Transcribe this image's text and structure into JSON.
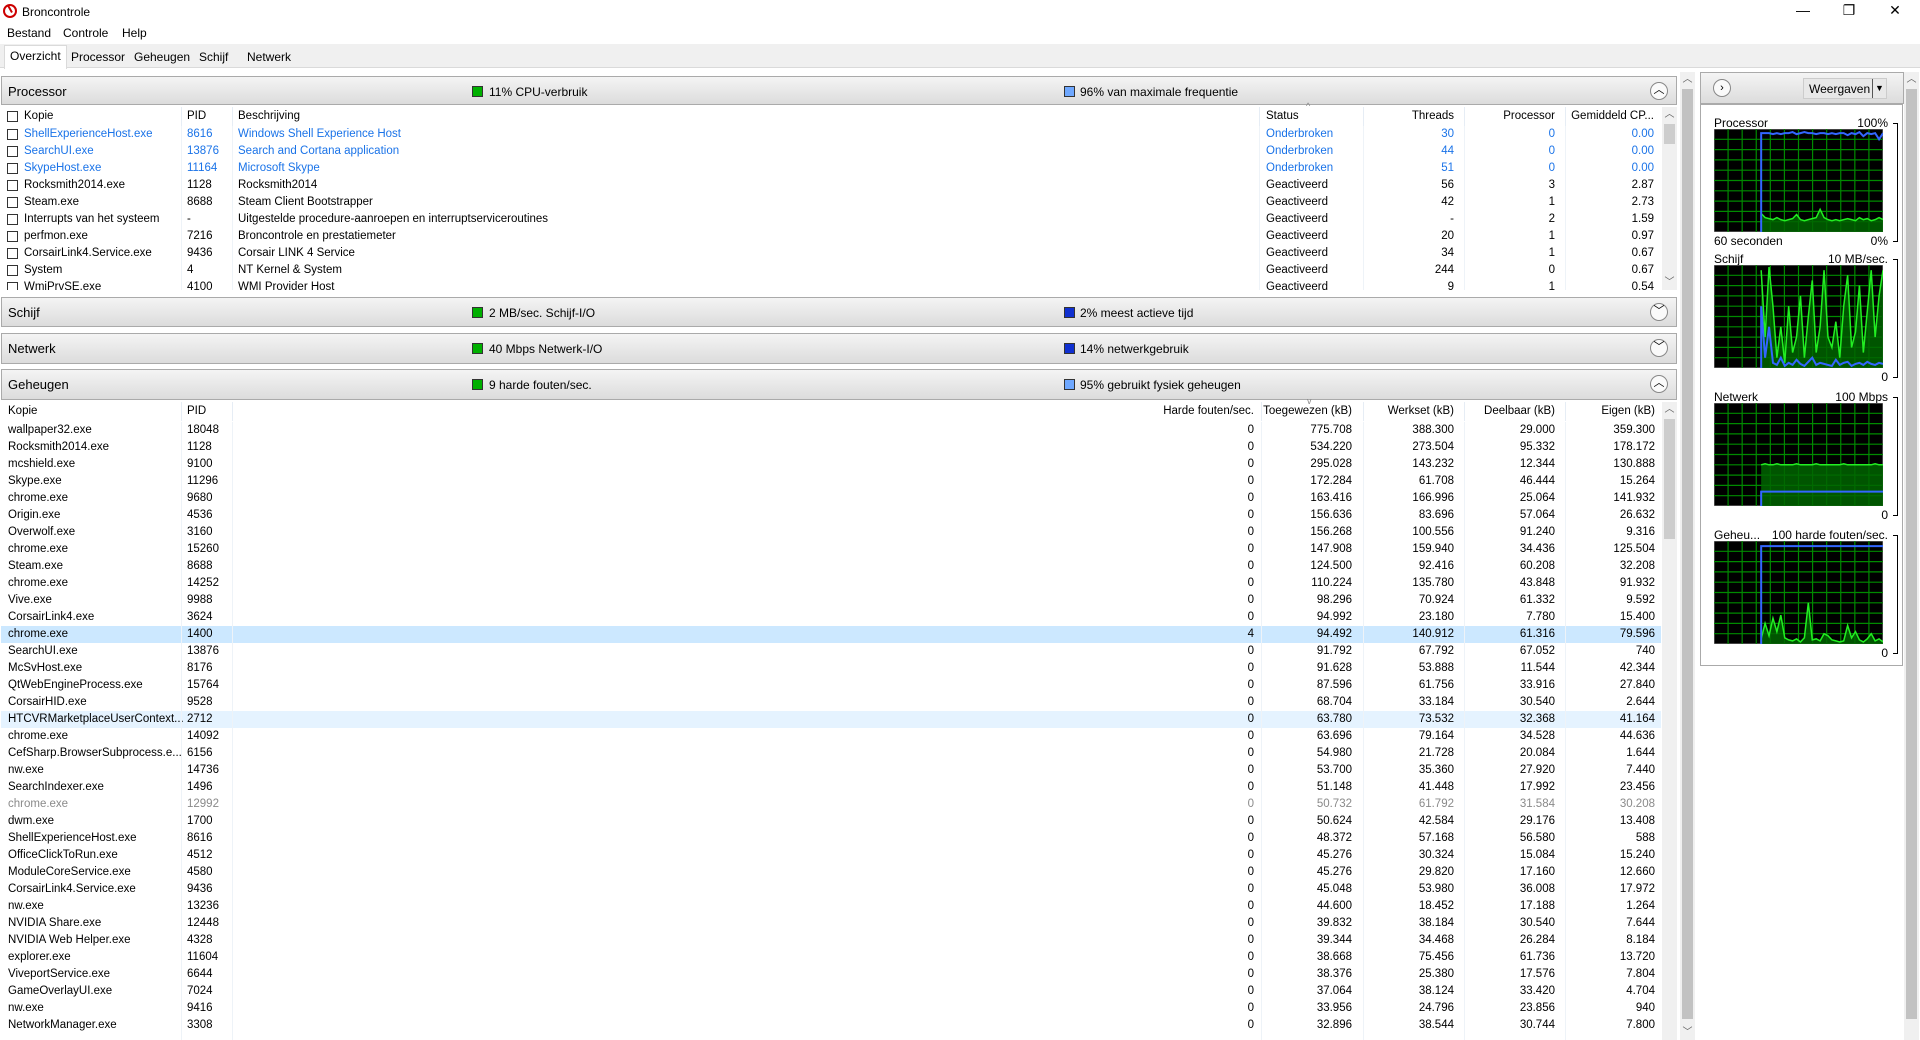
{
  "window": {
    "title": "Broncontrole",
    "minimize": "—",
    "restore": "❐",
    "close": "✕"
  },
  "menu": [
    "Bestand",
    "Controle",
    "Help"
  ],
  "tabs": [
    "Overzicht",
    "Processor",
    "Geheugen",
    "Schijf",
    "Netwerk"
  ],
  "colors": {
    "green": "#00b000",
    "blue": "#3366ff",
    "suspended": "#1a73e8",
    "selected": "#cce8ff",
    "hover": "#e5f3ff"
  },
  "processor": {
    "title": "Processor",
    "metric1": "11% CPU-verbruik",
    "metric2": "96% van maximale frequentie",
    "columns": [
      "Kopie",
      "PID",
      "Beschrijving",
      "Status",
      "Threads",
      "Processor",
      "Gemiddeld CP..."
    ],
    "rows": [
      {
        "name": "ShellExperienceHost.exe",
        "pid": "8616",
        "desc": "Windows Shell Experience Host",
        "status": "Onderbroken",
        "threads": "30",
        "cpu": "0",
        "avg": "0.00",
        "suspended": true
      },
      {
        "name": "SearchUI.exe",
        "pid": "13876",
        "desc": "Search and Cortana application",
        "status": "Onderbroken",
        "threads": "44",
        "cpu": "0",
        "avg": "0.00",
        "suspended": true
      },
      {
        "name": "SkypeHost.exe",
        "pid": "11164",
        "desc": "Microsoft Skype",
        "status": "Onderbroken",
        "threads": "51",
        "cpu": "0",
        "avg": "0.00",
        "suspended": true
      },
      {
        "name": "Rocksmith2014.exe",
        "pid": "1128",
        "desc": "Rocksmith2014",
        "status": "Geactiveerd",
        "threads": "56",
        "cpu": "3",
        "avg": "2.87"
      },
      {
        "name": "Steam.exe",
        "pid": "8688",
        "desc": "Steam Client Bootstrapper",
        "status": "Geactiveerd",
        "threads": "42",
        "cpu": "1",
        "avg": "2.73"
      },
      {
        "name": "Interrupts van het systeem",
        "pid": "-",
        "desc": "Uitgestelde procedure-aanroepen en interruptserviceroutines",
        "status": "Geactiveerd",
        "threads": "-",
        "cpu": "2",
        "avg": "1.59"
      },
      {
        "name": "perfmon.exe",
        "pid": "7216",
        "desc": "Broncontrole en prestatiemeter",
        "status": "Geactiveerd",
        "threads": "20",
        "cpu": "1",
        "avg": "0.97"
      },
      {
        "name": "CorsairLink4.Service.exe",
        "pid": "9436",
        "desc": "Corsair LINK 4 Service",
        "status": "Geactiveerd",
        "threads": "34",
        "cpu": "1",
        "avg": "0.67"
      },
      {
        "name": "System",
        "pid": "4",
        "desc": "NT Kernel & System",
        "status": "Geactiveerd",
        "threads": "244",
        "cpu": "0",
        "avg": "0.67"
      },
      {
        "name": "WmiPrvSE.exe",
        "pid": "4100",
        "desc": "WMI Provider Host",
        "status": "Geactiveerd",
        "threads": "9",
        "cpu": "1",
        "avg": "0.54"
      }
    ]
  },
  "disk": {
    "title": "Schijf",
    "metric1": "2 MB/sec. Schijf-I/O",
    "metric2": "2% meest actieve tijd"
  },
  "network": {
    "title": "Netwerk",
    "metric1": "40 Mbps  Netwerk-I/O",
    "metric2": "14% netwerkgebruik"
  },
  "memory": {
    "title": "Geheugen",
    "metric1": "9 harde fouten/sec.",
    "metric2": "95% gebruikt fysiek geheugen",
    "columns": [
      "Kopie",
      "PID",
      "Harde fouten/sec.",
      "Toegewezen (kB)",
      "Werkset (kB)",
      "Deelbaar (kB)",
      "Eigen (kB)"
    ],
    "rows": [
      [
        "wallpaper32.exe",
        "18048",
        "0",
        "775.708",
        "388.300",
        "29.000",
        "359.300"
      ],
      [
        "Rocksmith2014.exe",
        "1128",
        "0",
        "534.220",
        "273.504",
        "95.332",
        "178.172"
      ],
      [
        "mcshield.exe",
        "9100",
        "0",
        "295.028",
        "143.232",
        "12.344",
        "130.888"
      ],
      [
        "Skype.exe",
        "11296",
        "0",
        "172.284",
        "61.708",
        "46.444",
        "15.264"
      ],
      [
        "chrome.exe",
        "9680",
        "0",
        "163.416",
        "166.996",
        "25.064",
        "141.932"
      ],
      [
        "Origin.exe",
        "4536",
        "0",
        "156.636",
        "83.696",
        "57.064",
        "26.632"
      ],
      [
        "Overwolf.exe",
        "3160",
        "0",
        "156.268",
        "100.556",
        "91.240",
        "9.316"
      ],
      [
        "chrome.exe",
        "15260",
        "0",
        "147.908",
        "159.940",
        "34.436",
        "125.504"
      ],
      [
        "Steam.exe",
        "8688",
        "0",
        "124.500",
        "92.416",
        "60.208",
        "32.208"
      ],
      [
        "chrome.exe",
        "14252",
        "0",
        "110.224",
        "135.780",
        "43.848",
        "91.932"
      ],
      [
        "Vive.exe",
        "9988",
        "0",
        "98.296",
        "70.924",
        "61.332",
        "9.592"
      ],
      [
        "CorsairLink4.exe",
        "3624",
        "0",
        "94.992",
        "23.180",
        "7.780",
        "15.400"
      ],
      [
        "chrome.exe",
        "1400",
        "4",
        "94.492",
        "140.912",
        "61.316",
        "79.596"
      ],
      [
        "SearchUI.exe",
        "13876",
        "0",
        "91.792",
        "67.792",
        "67.052",
        "740"
      ],
      [
        "McSvHost.exe",
        "8176",
        "0",
        "91.628",
        "53.888",
        "11.544",
        "42.344"
      ],
      [
        "QtWebEngineProcess.exe",
        "15764",
        "0",
        "87.596",
        "61.756",
        "33.916",
        "27.840"
      ],
      [
        "CorsairHID.exe",
        "9528",
        "0",
        "68.704",
        "33.184",
        "30.540",
        "2.644"
      ],
      [
        "HTCVRMarketplaceUserContext...",
        "2712",
        "0",
        "63.780",
        "73.532",
        "32.368",
        "41.164"
      ],
      [
        "chrome.exe",
        "14092",
        "0",
        "63.696",
        "79.164",
        "34.528",
        "44.636"
      ],
      [
        "CefSharp.BrowserSubprocess.e...",
        "6156",
        "0",
        "54.980",
        "21.728",
        "20.084",
        "1.644"
      ],
      [
        "nw.exe",
        "14736",
        "0",
        "53.700",
        "35.360",
        "27.920",
        "7.440"
      ],
      [
        "SearchIndexer.exe",
        "1496",
        "0",
        "51.148",
        "41.448",
        "17.992",
        "23.456"
      ],
      [
        "chrome.exe",
        "12992",
        "0",
        "50.732",
        "61.792",
        "31.584",
        "30.208"
      ],
      [
        "dwm.exe",
        "1700",
        "0",
        "50.624",
        "42.584",
        "29.176",
        "13.408"
      ],
      [
        "ShellExperienceHost.exe",
        "8616",
        "0",
        "48.372",
        "57.168",
        "56.580",
        "588"
      ],
      [
        "OfficeClickToRun.exe",
        "4512",
        "0",
        "45.276",
        "30.324",
        "15.084",
        "15.240"
      ],
      [
        "ModuleCoreService.exe",
        "4580",
        "0",
        "45.276",
        "29.820",
        "17.160",
        "12.660"
      ],
      [
        "CorsairLink4.Service.exe",
        "9436",
        "0",
        "45.048",
        "53.980",
        "36.008",
        "17.972"
      ],
      [
        "nw.exe",
        "13236",
        "0",
        "44.600",
        "18.452",
        "17.188",
        "1.264"
      ],
      [
        "NVIDIA Share.exe",
        "12448",
        "0",
        "39.832",
        "38.184",
        "30.540",
        "7.644"
      ],
      [
        "NVIDIA Web Helper.exe",
        "4328",
        "0",
        "39.344",
        "34.468",
        "26.284",
        "8.184"
      ],
      [
        "explorer.exe",
        "11604",
        "0",
        "38.668",
        "75.456",
        "61.736",
        "13.720"
      ],
      [
        "ViveportService.exe",
        "6644",
        "0",
        "38.376",
        "25.380",
        "17.576",
        "7.804"
      ],
      [
        "GameOverlayUI.exe",
        "7024",
        "0",
        "37.064",
        "38.124",
        "33.420",
        "4.704"
      ],
      [
        "nw.exe",
        "9416",
        "0",
        "33.956",
        "24.796",
        "23.856",
        "940"
      ],
      [
        "NetworkManager.exe",
        "3308",
        "0",
        "32.896",
        "38.544",
        "30.744",
        "7.800"
      ]
    ],
    "selected_index": 12,
    "hover_index": 17,
    "dimmed_index": 22
  },
  "side": {
    "views_label": "Weergaven",
    "graphs": [
      {
        "name": "Processor",
        "max": "100%",
        "min": "0%",
        "time": "60 seconden",
        "green": [
          null,
          null,
          null,
          null,
          null,
          null,
          null,
          null,
          null,
          null,
          null,
          null,
          18,
          14,
          13,
          12,
          14,
          12,
          11,
          12,
          13,
          17,
          12,
          11,
          12,
          13,
          14,
          22,
          14,
          12,
          11,
          12,
          11,
          12,
          13,
          12,
          11,
          14,
          12,
          13,
          11,
          12,
          14,
          12
        ],
        "blue": [
          null,
          null,
          null,
          null,
          null,
          null,
          null,
          null,
          null,
          null,
          null,
          null,
          96,
          96,
          96,
          95,
          96,
          95,
          96,
          96,
          97,
          95,
          96,
          97,
          96,
          96,
          95,
          96,
          96,
          95,
          96,
          95,
          96,
          96,
          94,
          96,
          95,
          97,
          93,
          96,
          95,
          96,
          90,
          96
        ]
      },
      {
        "name": "Schijf",
        "max": "10 MB/sec.",
        "min": "0",
        "green": [
          null,
          null,
          null,
          null,
          null,
          null,
          null,
          null,
          null,
          null,
          null,
          null,
          95,
          30,
          98,
          60,
          10,
          40,
          5,
          60,
          15,
          30,
          70,
          10,
          50,
          85,
          15,
          40,
          95,
          30,
          20,
          45,
          10,
          60,
          90,
          20,
          35,
          80,
          15,
          55,
          95,
          30,
          70,
          95
        ],
        "blue": [
          null,
          null,
          null,
          null,
          null,
          null,
          null,
          null,
          null,
          null,
          null,
          null,
          60,
          10,
          40,
          5,
          3,
          10,
          2,
          5,
          3,
          8,
          4,
          2,
          6,
          10,
          3,
          5,
          4,
          3,
          2,
          8,
          3,
          5,
          6,
          2,
          4,
          5,
          3,
          6,
          4,
          3,
          5,
          4
        ]
      },
      {
        "name": "Netwerk",
        "max": "100 Mbps",
        "min": "0",
        "green": [
          null,
          null,
          null,
          null,
          null,
          null,
          null,
          null,
          null,
          null,
          null,
          null,
          40,
          41,
          40,
          40,
          41,
          40,
          40,
          40,
          40,
          41,
          40,
          40,
          40,
          40,
          41,
          40,
          40,
          40,
          40,
          40,
          40,
          41,
          40,
          40,
          40,
          40,
          40,
          40,
          40,
          41,
          40,
          40
        ],
        "blue": [
          null,
          null,
          null,
          null,
          null,
          null,
          null,
          null,
          null,
          null,
          null,
          null,
          14,
          14,
          14,
          14,
          14,
          14,
          14,
          14,
          14,
          14,
          14,
          14,
          14,
          14,
          14,
          14,
          14,
          14,
          14,
          14,
          14,
          14,
          14,
          14,
          14,
          14,
          14,
          14,
          14,
          14,
          14,
          14
        ]
      },
      {
        "name": "Geheu...",
        "max": "100 harde fouten/sec.",
        "min": "0",
        "green": [
          null,
          null,
          null,
          null,
          null,
          null,
          null,
          null,
          null,
          null,
          null,
          null,
          5,
          20,
          8,
          25,
          12,
          28,
          6,
          4,
          3,
          5,
          2,
          6,
          40,
          4,
          5,
          3,
          10,
          8,
          4,
          3,
          2,
          3,
          18,
          6,
          12,
          4,
          2,
          5,
          10,
          3,
          5,
          2
        ],
        "blue": [
          null,
          null,
          null,
          null,
          null,
          null,
          null,
          null,
          null,
          null,
          null,
          null,
          95,
          95,
          95,
          95,
          95,
          95,
          95,
          95,
          95,
          95,
          95,
          95,
          95,
          95,
          95,
          95,
          95,
          95,
          95,
          95,
          95,
          95,
          95,
          95,
          95,
          95,
          95,
          95,
          95,
          95,
          95,
          95
        ]
      }
    ]
  }
}
